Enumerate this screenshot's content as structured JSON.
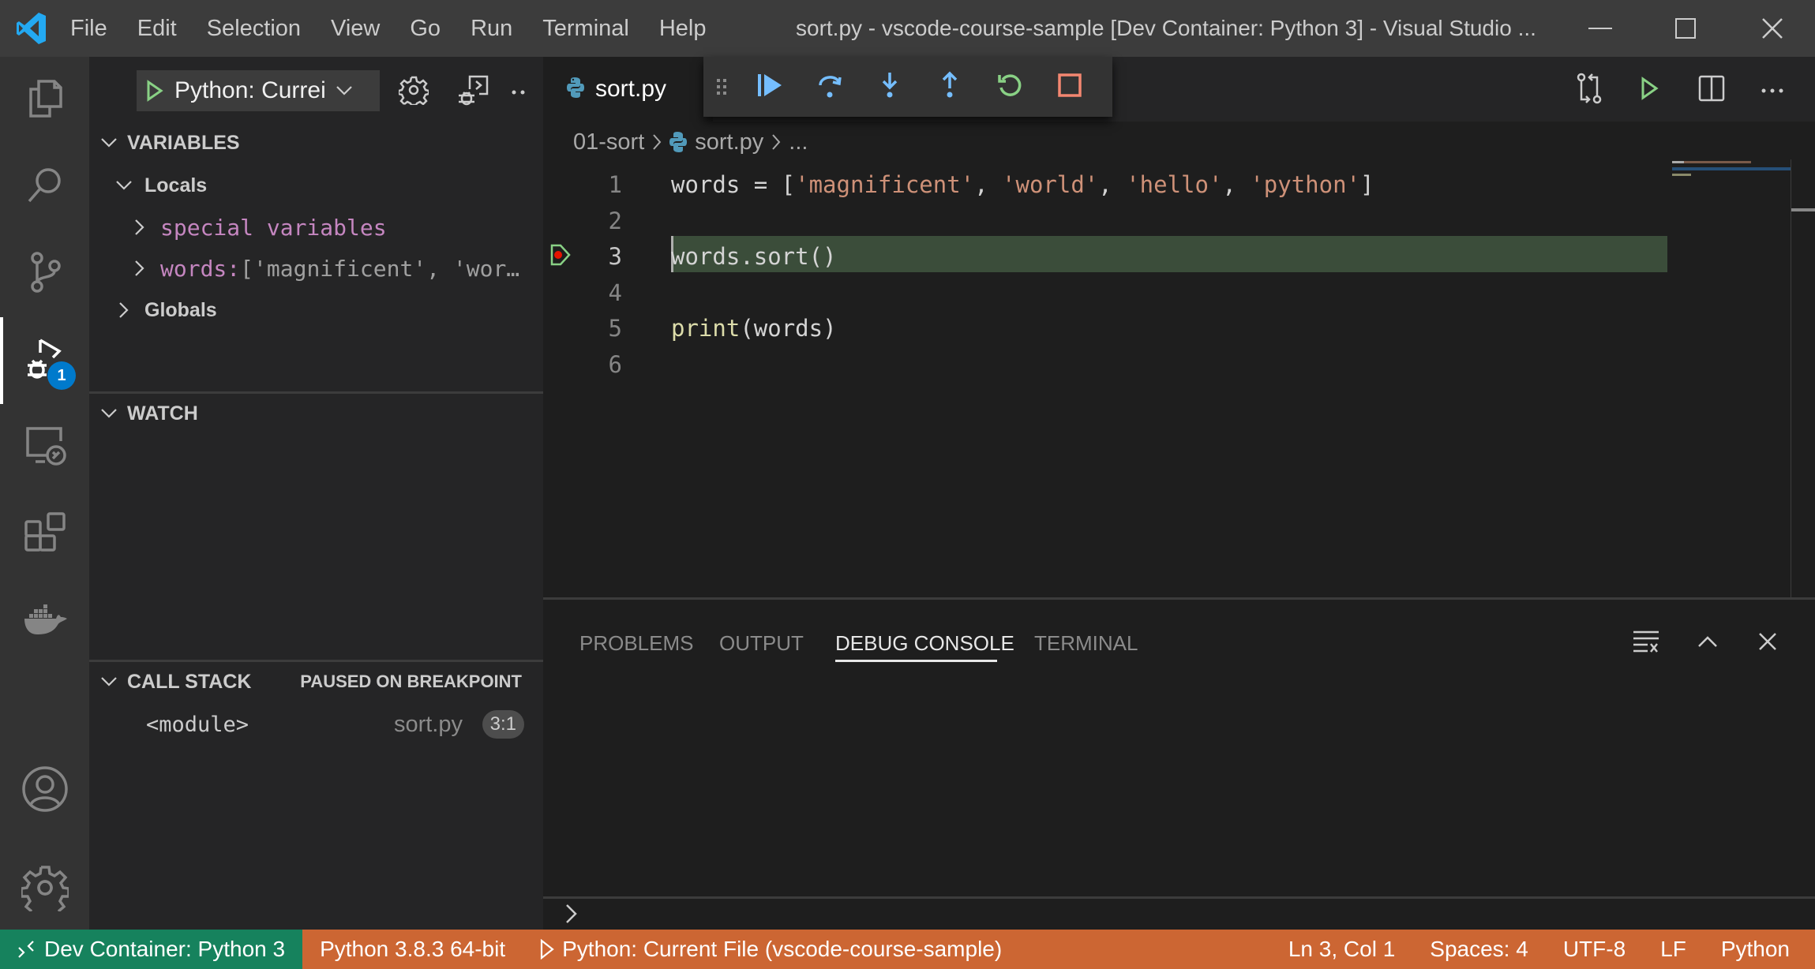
{
  "titlebar": {
    "menu": [
      "File",
      "Edit",
      "Selection",
      "View",
      "Go",
      "Run",
      "Terminal",
      "Help"
    ],
    "window_title": "sort.py - vscode-course-sample [Dev Container: Python 3] - Visual Studio ..."
  },
  "activitybar": {
    "items": [
      {
        "name": "explorer",
        "icon": "files-icon"
      },
      {
        "name": "search",
        "icon": "search-icon"
      },
      {
        "name": "source-control",
        "icon": "source-control-icon"
      },
      {
        "name": "run-debug",
        "icon": "debug-icon",
        "active": true,
        "badge": "1"
      },
      {
        "name": "remote-explorer",
        "icon": "remote-explorer-icon"
      },
      {
        "name": "extensions",
        "icon": "extensions-icon"
      },
      {
        "name": "docker",
        "icon": "docker-icon"
      },
      {
        "name": "accounts",
        "icon": "account-icon"
      },
      {
        "name": "manage",
        "icon": "gear-icon"
      }
    ]
  },
  "sidebar": {
    "launch_config": "Python: Current File",
    "launch_config_visible": "Python: Currei",
    "variables": {
      "header": "VARIABLES",
      "locals_label": "Locals",
      "special_variables": "special variables",
      "words_name": "words:",
      "words_value": " ['magnificent', 'wor…",
      "globals_label": "Globals"
    },
    "watch": {
      "header": "WATCH"
    },
    "call_stack": {
      "header": "CALL STACK",
      "status": "PAUSED ON BREAKPOINT",
      "frames": [
        {
          "name": "<module>",
          "file": "sort.py",
          "position": "3:1"
        }
      ]
    }
  },
  "editor": {
    "tab_label": "sort.py",
    "breadcrumb": [
      "01-sort",
      "sort.py",
      "..."
    ],
    "current_line": 3,
    "lines": [
      {
        "no": "1",
        "parts": [
          {
            "t": "words = [",
            "c": "plain"
          },
          {
            "t": "'magnificent'",
            "c": "str"
          },
          {
            "t": ", ",
            "c": "plain"
          },
          {
            "t": "'world'",
            "c": "str"
          },
          {
            "t": ", ",
            "c": "plain"
          },
          {
            "t": "'hello'",
            "c": "str"
          },
          {
            "t": ", ",
            "c": "plain"
          },
          {
            "t": "'python'",
            "c": "str"
          },
          {
            "t": "]",
            "c": "plain"
          }
        ]
      },
      {
        "no": "2",
        "parts": []
      },
      {
        "no": "3",
        "parts": [
          {
            "t": "words.sort()",
            "c": "plain"
          }
        ]
      },
      {
        "no": "4",
        "parts": []
      },
      {
        "no": "5",
        "parts": [
          {
            "t": "print",
            "c": "fn"
          },
          {
            "t": "(words)",
            "c": "plain"
          }
        ]
      },
      {
        "no": "6",
        "parts": []
      }
    ]
  },
  "debug_toolbar": {
    "buttons": [
      "continue",
      "step-over",
      "step-into",
      "step-out",
      "restart",
      "stop"
    ]
  },
  "panel": {
    "tabs": [
      "PROBLEMS",
      "OUTPUT",
      "DEBUG CONSOLE",
      "TERMINAL"
    ],
    "active_tab": "DEBUG CONSOLE"
  },
  "statusbar": {
    "remote": "Dev Container: Python 3",
    "interpreter": "Python 3.8.3 64-bit",
    "launch": "Python: Current File (vscode-course-sample)",
    "position": "Ln 3, Col 1",
    "indent": "Spaces: 4",
    "encoding": "UTF-8",
    "eol": "LF",
    "language": "Python"
  },
  "colors": {
    "statusbar_debug": "#cc6633",
    "remote_indicator": "#16825d",
    "badge": "#007acc",
    "current_line": "#3b4d3a"
  }
}
